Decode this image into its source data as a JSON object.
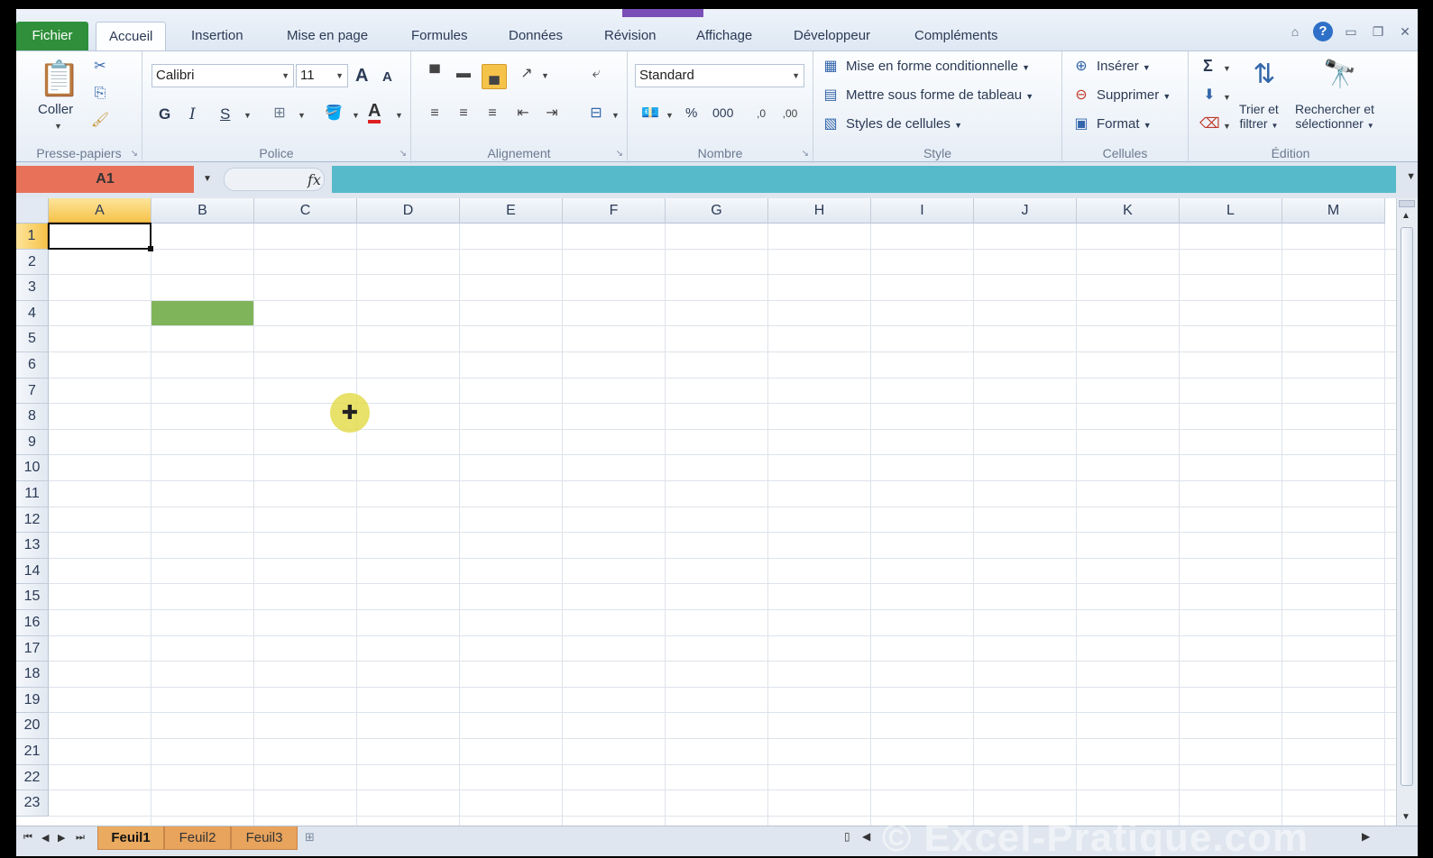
{
  "tabs": {
    "file": "Fichier",
    "items": [
      "Accueil",
      "Insertion",
      "Mise en page",
      "Formules",
      "Données",
      "Révision",
      "Affichage",
      "Développeur",
      "Compléments"
    ],
    "active": "Accueil"
  },
  "ribbon": {
    "clipboard": {
      "paste_label": "Coller",
      "group_label": "Presse-papiers"
    },
    "font": {
      "name": "Calibri",
      "size": "11",
      "group_label": "Police",
      "bold": "G",
      "italic": "I",
      "underline": "S",
      "grow": "A",
      "shrink": "A",
      "color_glyph": "A"
    },
    "alignment": {
      "group_label": "Alignement"
    },
    "number": {
      "format": "Standard",
      "group_label": "Nombre",
      "percent": "%",
      "thousands": "000"
    },
    "style": {
      "group_label": "Style",
      "conditional": "Mise en forme conditionnelle",
      "as_table": "Mettre sous forme de tableau",
      "cell_styles": "Styles de cellules"
    },
    "cells": {
      "group_label": "Cellules",
      "insert": "Insérer",
      "delete": "Supprimer",
      "format": "Format"
    },
    "editing": {
      "group_label": "Édition",
      "sort_line1": "Trier et",
      "sort_line2": "filtrer",
      "find_line1": "Rechercher et",
      "find_line2": "sélectionner",
      "sum_glyph": "Σ"
    }
  },
  "formula_bar": {
    "name_box": "A1",
    "fx": "fx",
    "value": ""
  },
  "grid": {
    "columns": [
      "A",
      "B",
      "C",
      "D",
      "E",
      "F",
      "G",
      "H",
      "I",
      "J",
      "K",
      "L",
      "M"
    ],
    "rows": [
      "1",
      "2",
      "3",
      "4",
      "5",
      "6",
      "7",
      "8",
      "9",
      "10",
      "11",
      "12",
      "13",
      "14",
      "15",
      "16",
      "17",
      "18",
      "19",
      "20",
      "21",
      "22",
      "23"
    ],
    "selected_cell": "A1",
    "filled_cell": "B4",
    "filled_color": "#80b45a"
  },
  "sheets": {
    "tabs": [
      "Feuil1",
      "Feuil2",
      "Feuil3"
    ],
    "active": "Feuil1"
  },
  "watermark": "© Excel-Pratique.com",
  "colors": {
    "name_box": "#e8715a",
    "formula_input": "#56bacb",
    "file_tab": "#2f8f3a",
    "selection_header": "#f6c34a"
  }
}
